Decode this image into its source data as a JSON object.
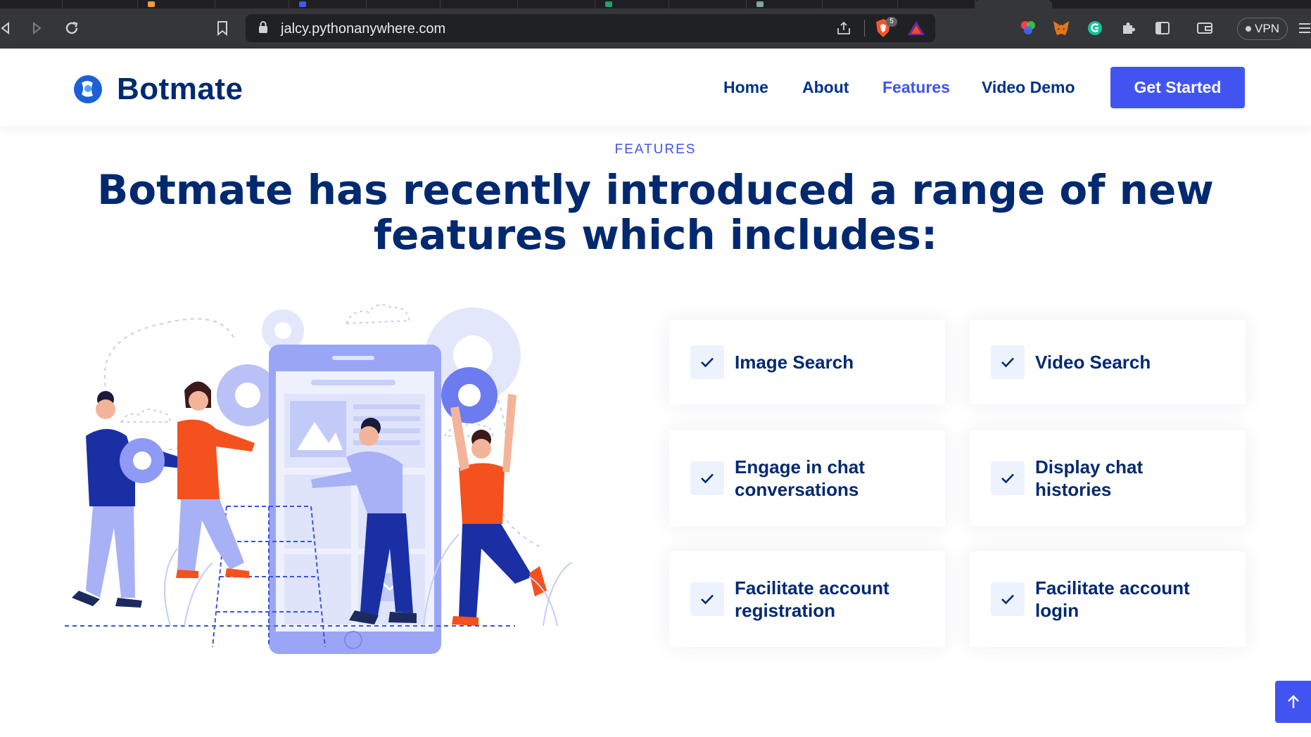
{
  "browser": {
    "url": "jalcy.pythonanywhere.com",
    "shield_count": "5",
    "vpn_label": "VPN"
  },
  "site": {
    "brand": "Botmate",
    "nav": {
      "home": "Home",
      "about": "About",
      "features": "Features",
      "video_demo": "Video Demo"
    },
    "cta_label": "Get Started"
  },
  "section": {
    "eyebrow": "FEATURES",
    "title": "Botmate has recently introduced a range of new features which includes:"
  },
  "features": [
    {
      "label": "Image Search"
    },
    {
      "label": "Video Search"
    },
    {
      "label": "Engage in chat conversations"
    },
    {
      "label": "Display chat histories"
    },
    {
      "label": "Facilitate account registration"
    },
    {
      "label": "Facilitate account login"
    }
  ],
  "colors": {
    "primary": "#4154f1",
    "heading": "#012970",
    "check_bg": "#ecf3ff"
  },
  "icons": {
    "feature_check": "check-icon",
    "back_to_top": "arrow-up-icon"
  }
}
